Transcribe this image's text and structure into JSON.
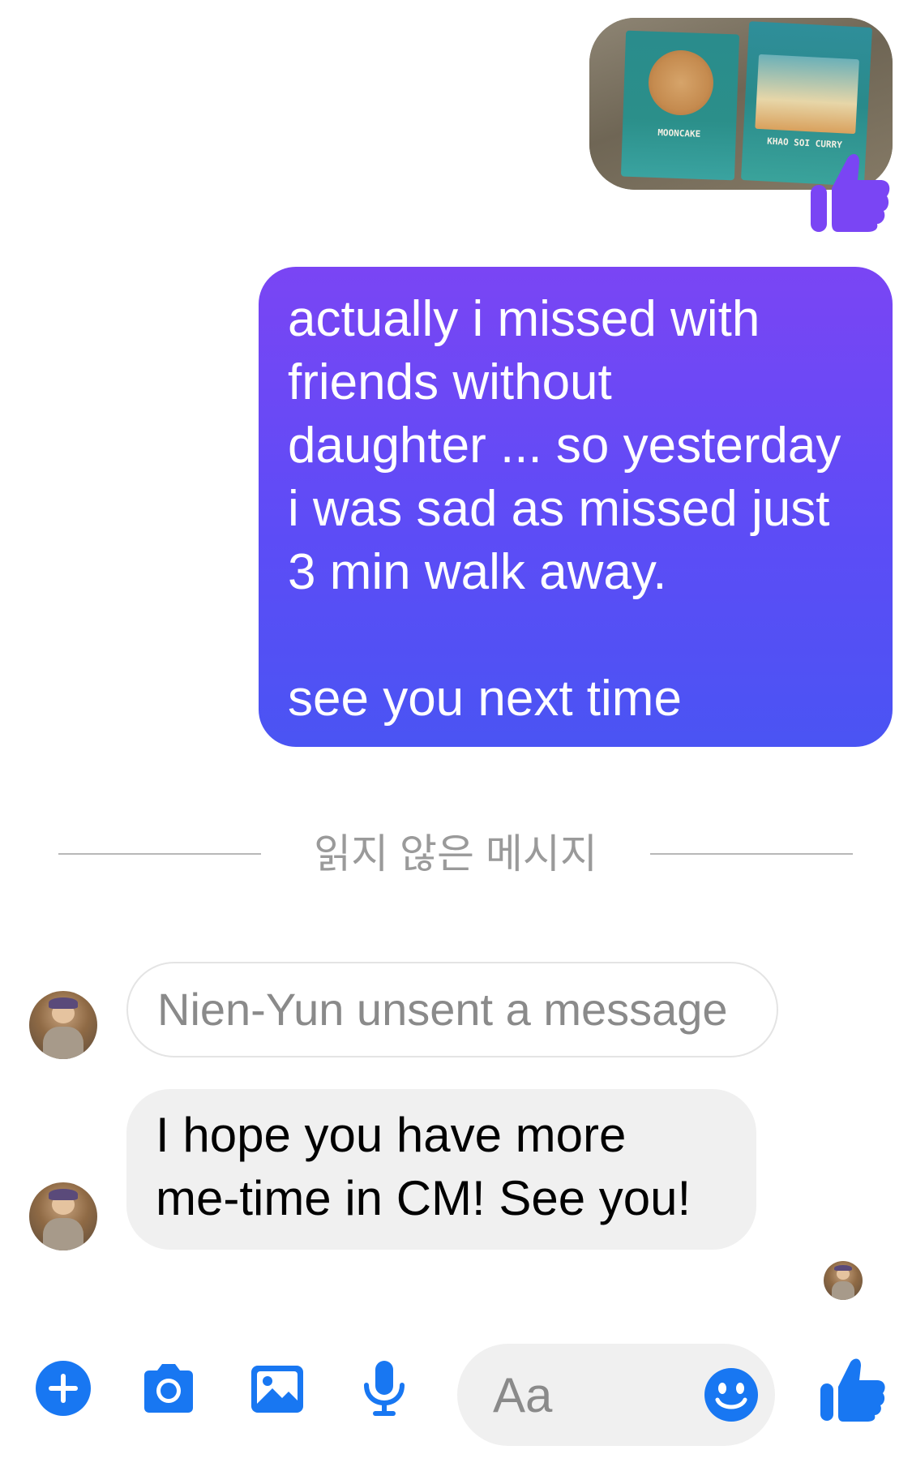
{
  "colors": {
    "accent": "#1877f2",
    "outgoing_gradient_top": "#7a45f4",
    "outgoing_gradient_bottom": "#4a54f3",
    "incoming_bubble": "#f0f0f0",
    "reaction": "#7a45f4"
  },
  "messages": {
    "outgoing_photo": {
      "icon": "photo-attachment",
      "package_left_label": "MOONCAKE",
      "package_right_label": "KHAO SOI CURRY",
      "reaction_icon": "thumbs-up-icon"
    },
    "outgoing_text": "actually i missed with\nfriends without\ndaughter ... so yesterday\ni was sad as missed just\n3 min walk away.\n\nsee you next time",
    "unread_divider": "읽지 않은 메시지",
    "unsent_notice": "Nien-Yun unsent a message",
    "incoming_text": "I hope you have more\nme-time in CM! See you!"
  },
  "composer": {
    "placeholder": "Aa",
    "icons": [
      "plus-icon",
      "camera-icon",
      "photo-icon",
      "microphone-icon",
      "emoji-icon",
      "thumbs-up-icon"
    ]
  }
}
